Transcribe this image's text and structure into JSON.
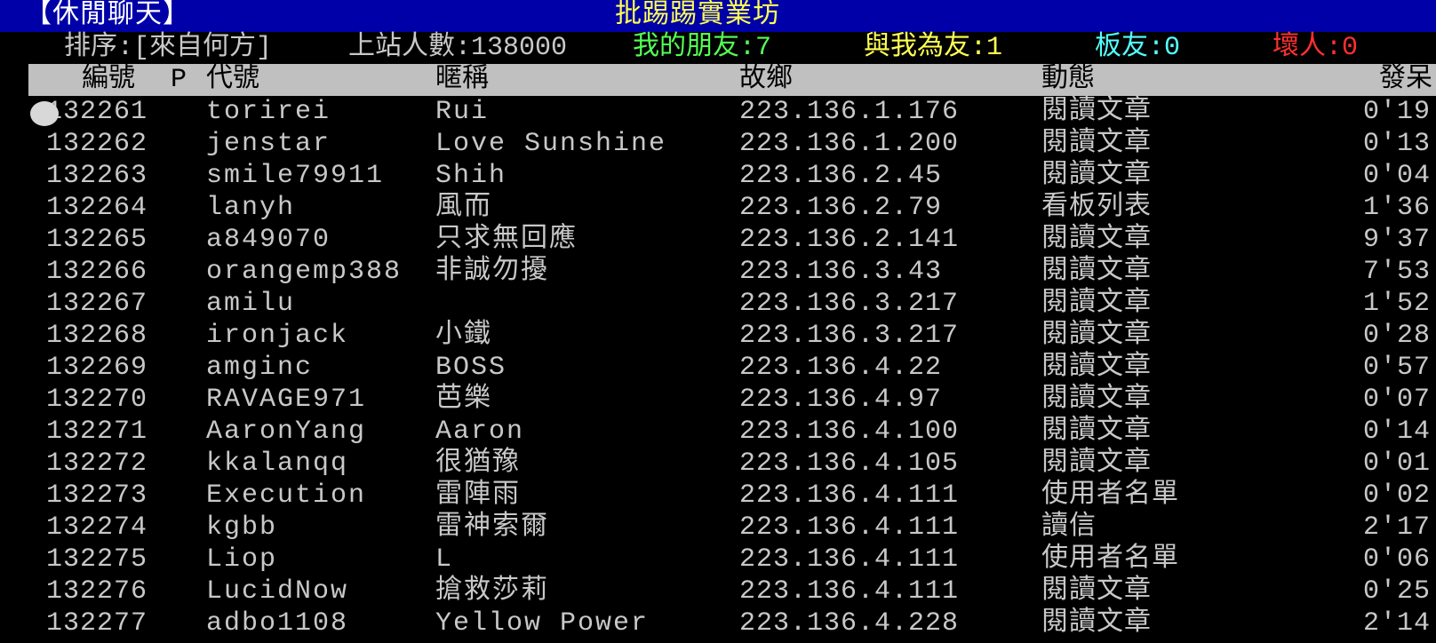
{
  "title": {
    "board": "【休閒聊天】",
    "site": "批踢踢實業坊"
  },
  "status": {
    "sort": "排序:[來自何方]",
    "online": "上站人數:138000",
    "my_friends": "我的朋友:7",
    "friend_of": "與我為友:1",
    "board_friends": "板友:0",
    "bad": "壞人:0"
  },
  "colors": {
    "title_bg": "#0000a8",
    "title_site": "#ffff54",
    "my_friends": "#54ff54",
    "friend_of": "#ffff54",
    "board_friends": "#54ffff",
    "bad": "#ff3030",
    "header_bg": "#c0c0c0"
  },
  "columns": {
    "num": "編號",
    "p": "P",
    "id": "代號",
    "nick": "暱稱",
    "from": "故鄉",
    "action": "動態",
    "idle": "發呆"
  },
  "rows": [
    {
      "num": "132261",
      "id": "torirei",
      "nick": "Rui",
      "from": "223.136.1.176",
      "action": "閱讀文章",
      "idle": "0'19"
    },
    {
      "num": "132262",
      "id": "jenstar",
      "nick": "Love Sunshine",
      "from": "223.136.1.200",
      "action": "閱讀文章",
      "idle": "0'13"
    },
    {
      "num": "132263",
      "id": "smile79911",
      "nick": "Shih",
      "from": "223.136.2.45",
      "action": "閱讀文章",
      "idle": "0'04"
    },
    {
      "num": "132264",
      "id": "lanyh",
      "nick": "風而",
      "from": "223.136.2.79",
      "action": "看板列表",
      "idle": "1'36"
    },
    {
      "num": "132265",
      "id": "a849070",
      "nick": "只求無回應",
      "from": "223.136.2.141",
      "action": "閱讀文章",
      "idle": "9'37"
    },
    {
      "num": "132266",
      "id": "orangemp388",
      "nick": "非誠勿擾",
      "from": "223.136.3.43",
      "action": "閱讀文章",
      "idle": "7'53"
    },
    {
      "num": "132267",
      "id": "amilu",
      "nick": "",
      "from": "223.136.3.217",
      "action": "閱讀文章",
      "idle": "1'52"
    },
    {
      "num": "132268",
      "id": "ironjack",
      "nick": "小鐵",
      "from": "223.136.3.217",
      "action": "閱讀文章",
      "idle": "0'28"
    },
    {
      "num": "132269",
      "id": "amginc",
      "nick": "BOSS",
      "from": "223.136.4.22",
      "action": "閱讀文章",
      "idle": "0'57"
    },
    {
      "num": "132270",
      "id": "RAVAGE971",
      "nick": "芭樂",
      "from": "223.136.4.97",
      "action": "閱讀文章",
      "idle": "0'07"
    },
    {
      "num": "132271",
      "id": "AaronYang",
      "nick": "Aaron",
      "from": "223.136.4.100",
      "action": "閱讀文章",
      "idle": "0'14"
    },
    {
      "num": "132272",
      "id": "kkalanqq",
      "nick": "很猶豫",
      "from": "223.136.4.105",
      "action": "閱讀文章",
      "idle": "0'01"
    },
    {
      "num": "132273",
      "id": "Execution",
      "nick": "雷陣雨",
      "from": "223.136.4.111",
      "action": "使用者名單",
      "idle": "0'02"
    },
    {
      "num": "132274",
      "id": "kgbb",
      "nick": "雷神索爾",
      "from": "223.136.4.111",
      "action": "讀信",
      "idle": "2'17"
    },
    {
      "num": "132275",
      "id": "Liop",
      "nick": "L",
      "from": "223.136.4.111",
      "action": "使用者名單",
      "idle": "0'06"
    },
    {
      "num": "132276",
      "id": "LucidNow",
      "nick": "搶救莎莉",
      "from": "223.136.4.111",
      "action": "閱讀文章",
      "idle": "0'25"
    },
    {
      "num": "132277",
      "id": "adbo1108",
      "nick": "Yellow Power",
      "from": "223.136.4.228",
      "action": "閱讀文章",
      "idle": "2'14"
    }
  ]
}
